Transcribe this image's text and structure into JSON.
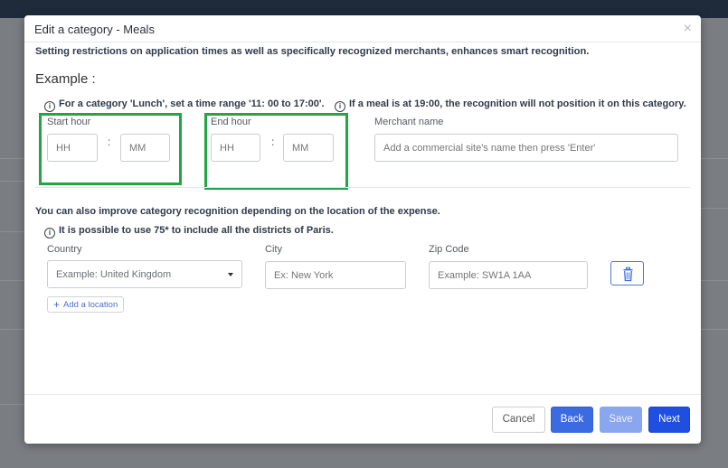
{
  "dialog": {
    "title": "Edit a category - Meals",
    "close_glyph": "×",
    "intro": "Setting restrictions on application times as well as specifically recognized merchants, enhances smart recognition.",
    "example_title": "Example :",
    "example_tip_1": "For a category 'Lunch', set a time range '11: 00 to 17:00'.",
    "example_tip_2": "If a meal is at 19:00, the recognition will not position it on this category.",
    "start_hour": {
      "label": "Start hour",
      "hh_placeholder": "HH",
      "mm_placeholder": "MM",
      "separator": ":"
    },
    "end_hour": {
      "label": "End hour",
      "hh_placeholder": "HH",
      "mm_placeholder": "MM",
      "separator": ":"
    },
    "merchant": {
      "label": "Merchant name",
      "placeholder": "Add a commercial site's name then press 'Enter'"
    },
    "location_intro": "You can also improve category recognition depending on the location of the expense.",
    "location_tip": "It is possible to use 75* to include all the districts of Paris.",
    "country": {
      "label": "Country",
      "placeholder": "Example: United Kingdom"
    },
    "city": {
      "label": "City",
      "placeholder": "Ex: New York"
    },
    "zip": {
      "label": "Zip Code",
      "placeholder": "Example: SW1A 1AA"
    },
    "add_location_label": "Add a location",
    "buttons": {
      "cancel": "Cancel",
      "back": "Back",
      "save": "Save",
      "next": "Next"
    }
  },
  "icons": {
    "info": "info-icon",
    "trash": "trash-icon",
    "plus": "plus-icon",
    "caret": "caret-down-icon",
    "close": "close-icon"
  },
  "colors": {
    "primary": "#1f4fe0",
    "back_button": "#3b6be0",
    "save_disabled": "#8aa6ef",
    "highlight_box": "#22a545",
    "overlay": "#7a7d82"
  }
}
